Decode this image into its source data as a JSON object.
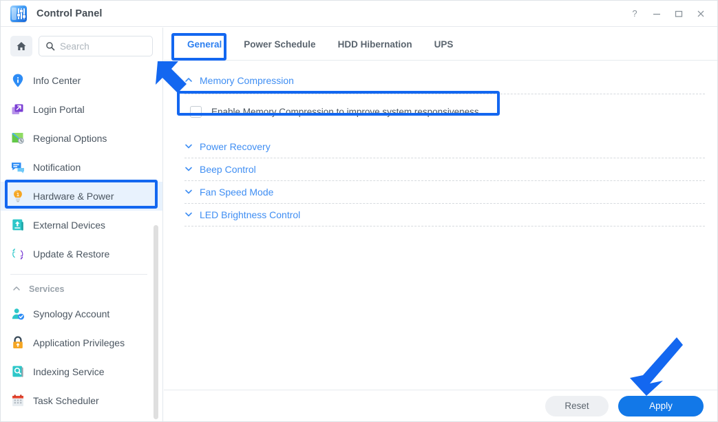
{
  "window": {
    "title": "Control Panel",
    "app_icon": "control-panel-icon",
    "controls": [
      {
        "name": "help-button",
        "glyph": "?"
      },
      {
        "name": "minimize-button",
        "glyph": "—"
      },
      {
        "name": "maximize-button",
        "glyph": "▢"
      },
      {
        "name": "close-button",
        "glyph": "✕"
      }
    ]
  },
  "sidebar": {
    "home_icon": "home-icon",
    "search": {
      "placeholder": "Search",
      "value": "",
      "icon": "search-icon"
    },
    "items": [
      {
        "label": "Info Center",
        "icon": "info-center-icon",
        "selected": false
      },
      {
        "label": "Login Portal",
        "icon": "login-portal-icon",
        "selected": false
      },
      {
        "label": "Regional Options",
        "icon": "regional-options-icon",
        "selected": false
      },
      {
        "label": "Notification",
        "icon": "notification-icon",
        "selected": false
      },
      {
        "label": "Hardware & Power",
        "icon": "hardware-power-icon",
        "selected": true
      },
      {
        "label": "External Devices",
        "icon": "external-devices-icon",
        "selected": false
      },
      {
        "label": "Update & Restore",
        "icon": "update-restore-icon",
        "selected": false
      }
    ],
    "group": {
      "label": "Services",
      "collapse_icon": "chevron-up-icon",
      "items": [
        {
          "label": "Synology Account",
          "icon": "synology-account-icon"
        },
        {
          "label": "Application Privileges",
          "icon": "application-privileges-icon"
        },
        {
          "label": "Indexing Service",
          "icon": "indexing-service-icon"
        },
        {
          "label": "Task Scheduler",
          "icon": "task-scheduler-icon"
        }
      ]
    }
  },
  "main": {
    "tabs": [
      {
        "label": "General",
        "active": true
      },
      {
        "label": "Power Schedule",
        "active": false
      },
      {
        "label": "HDD Hibernation",
        "active": false
      },
      {
        "label": "UPS",
        "active": false
      }
    ],
    "memory_compression": {
      "section_title": "Memory Compression",
      "expanded": true,
      "caret_icon": "chevron-up-icon",
      "checkbox": {
        "label": "Enable Memory Compression to improve system responsiveness",
        "checked": false
      }
    },
    "sections": [
      {
        "label": "Power Recovery",
        "caret_icon": "chevron-down-icon",
        "expanded": false
      },
      {
        "label": "Beep Control",
        "caret_icon": "chevron-down-icon",
        "expanded": false
      },
      {
        "label": "Fan Speed Mode",
        "caret_icon": "chevron-down-icon",
        "expanded": false
      },
      {
        "label": "LED Brightness Control",
        "caret_icon": "chevron-down-icon",
        "expanded": false
      }
    ]
  },
  "footer": {
    "reset_label": "Reset",
    "apply_label": "Apply"
  },
  "annotations": {
    "highlight_color": "#1367f0",
    "boxes": [
      {
        "name": "sidebar-highlight-box",
        "target": "Hardware & Power"
      },
      {
        "name": "tab-highlight-box",
        "target": "General"
      },
      {
        "name": "checkbox-highlight-box",
        "target": "Enable Memory Compression to improve system responsiveness"
      }
    ],
    "arrows": [
      {
        "name": "arrow-to-checkbox",
        "direction": "down-right"
      },
      {
        "name": "arrow-to-apply",
        "direction": "down-left"
      }
    ]
  },
  "colors": {
    "accent": "#1278e8",
    "link": "#3f8ef3",
    "selected_bg": "#e8f2fd",
    "annotation": "#1367f0"
  }
}
